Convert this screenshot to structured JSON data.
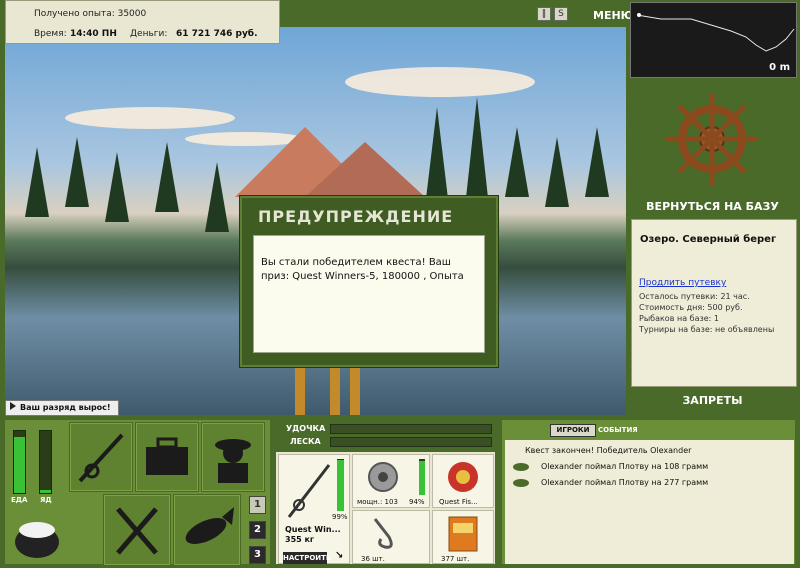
{
  "info": {
    "exp_text": "Получено опыта: 35000",
    "time_label": "Время:",
    "time_value": "14:40 ПН",
    "money_label": "Деньги:",
    "money_value": "61 721 746 руб."
  },
  "top": {
    "menu_label": "МЕНЮ"
  },
  "depth": {
    "readout": "0 m"
  },
  "right": {
    "return_label": "ВЕРНУТЬСЯ НА БАЗУ",
    "location_title": "Озеро. Северный берег",
    "extend_link": "Продлить путевку",
    "lines": [
      "Осталось путевки: 21 час.",
      "Стоимость дня: 500 руб.",
      "Рыбаков на базе: 1",
      "Турниры на базе: не объявлены"
    ],
    "bans_label": "ЗАПРЕТЫ"
  },
  "dialog": {
    "title": "ПРЕДУПРЕЖДЕНИЕ",
    "text": "Вы стали победителем квеста! Ваш приз: Quest Winners-5, 180000 , Опыта"
  },
  "rank": {
    "text": "Ваш разряд вырос!"
  },
  "bottom_left": {
    "food_label": "ЕДА",
    "poison_label": "ЯД",
    "food_level": 0.9,
    "poison_level": 0.05,
    "nums": [
      "1",
      "2",
      "3"
    ]
  },
  "tackle": {
    "rod_label": "УДОЧКА",
    "line_label": "ЛЕСКА",
    "rod_name": "Quest Win...",
    "rod_weight": "355 кг",
    "rod_pct": "99%",
    "reel_info": "мощн.: 103",
    "reel_pct": "94%",
    "line_name": "Quest Fis...",
    "hook_count": "36 шт.",
    "bait_count": "377 шт.",
    "setup_label": "НАСТРОИТЬ"
  },
  "chat": {
    "tab_players": "ИГРОКИ",
    "tab_events": "СОБЫТИЯ",
    "lines": [
      "Квест закончен! Победитель Olexander",
      "Olexander поймал Плотву на 108 грамм",
      "Olexander поймал Плотву на 277 грамм"
    ]
  },
  "colors": {
    "panel_green": "#4a6a2a",
    "accent_green": "#39c236",
    "link_blue": "#1a33cc"
  }
}
